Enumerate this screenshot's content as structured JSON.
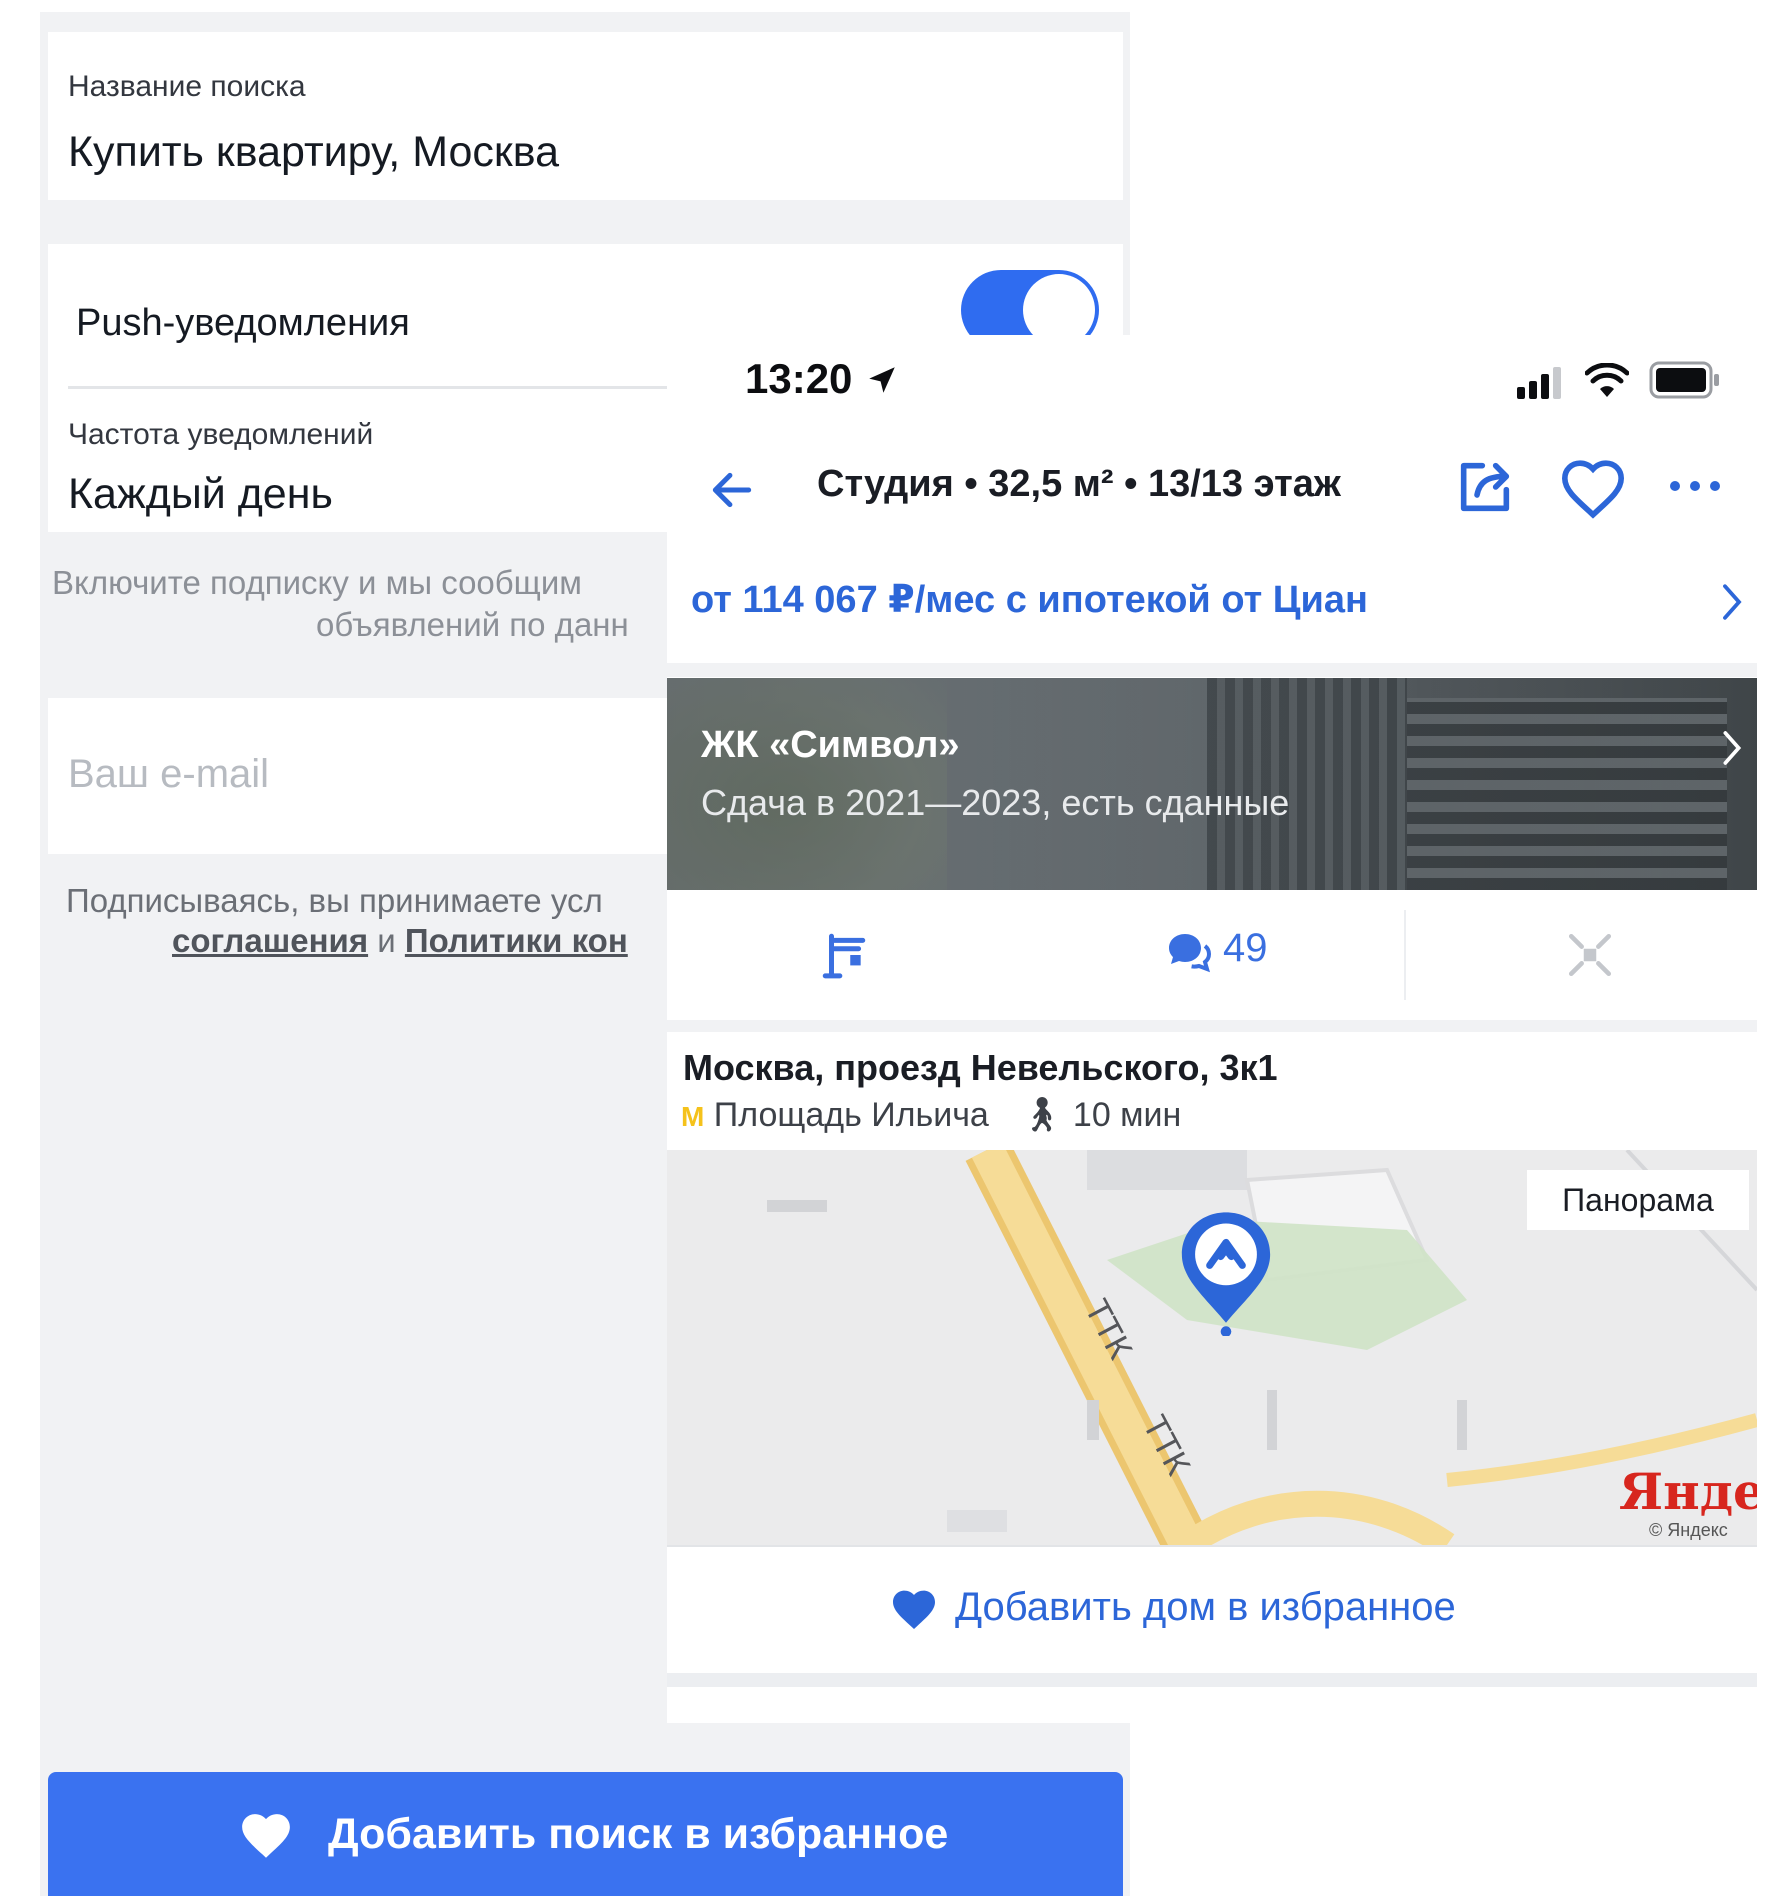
{
  "search_form": {
    "name_label": "Название поиска",
    "name_value": "Купить квартиру, Москва",
    "push_label": "Push-уведомления",
    "frequency_label": "Частота уведомлений",
    "frequency_value": "Каждый день",
    "hint_line1": "Включите подписку и мы сообщим",
    "hint_line2": "объявлений по данн",
    "email_placeholder": "Ваш e-mail",
    "terms_line1": "Подписываясь, вы принимаете усл",
    "terms_link1": "соглашения",
    "terms_and": "и",
    "terms_link2": "Политики кон",
    "cta_label": "Добавить поиск в избранное"
  },
  "listing": {
    "status_time": "13:20",
    "title": "Студия  •  32,5 м²  •  13/13 этаж",
    "mortgage": "от 114 067 ₽/мес с ипотекой от Циан",
    "complex_title": "ЖК «Символ»",
    "complex_subtitle": "Сдача в 2021—2023, есть сданные",
    "comments_count": "49",
    "address": "Москва, проезд Невельского, 3к1",
    "metro_icon": "М",
    "metro_station": "Площадь Ильича",
    "walk_time": "10 мин",
    "map_panorama": "Панорама",
    "map_road_1": "ТТК",
    "map_road_2": "ТТК",
    "map_brand": "Яндекс",
    "map_copyright": "© Яндекс",
    "add_house": "Добавить дом в избранное"
  },
  "colors": {
    "accent_blue": "#2f6cf0",
    "link_blue": "#2c66d8",
    "background_gray": "#f1f2f4",
    "metro_yellow": "#f5c21b",
    "yandex_red": "#d7261e"
  }
}
